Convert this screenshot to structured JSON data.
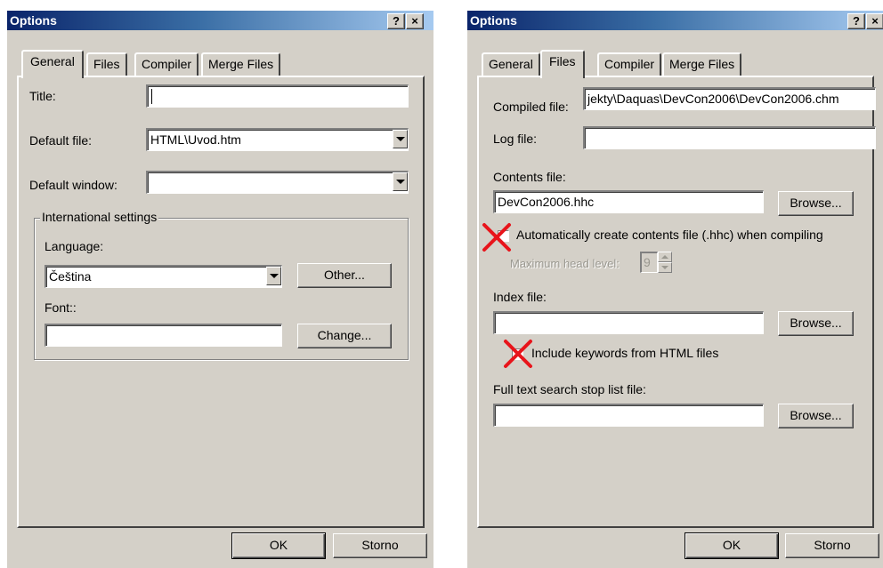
{
  "left_dialog": {
    "title": "Options",
    "help_button": "?",
    "close_button": "×",
    "tabs": [
      "General",
      "Files",
      "Compiler",
      "Merge Files"
    ],
    "active_tab": "General",
    "title_label": "Title:",
    "title_value": "",
    "default_file_label": "Default file:",
    "default_file_value": "HTML\\Uvod.htm",
    "default_window_label": "Default window:",
    "default_window_value": "",
    "intl_group_label": "International settings",
    "language_label": "Language:",
    "language_value": "Čeština",
    "other_button": "Other...",
    "font_label": "Font::",
    "font_value": "",
    "change_button": "Change...",
    "ok_button": "OK",
    "cancel_button": "Storno"
  },
  "right_dialog": {
    "title": "Options",
    "help_button": "?",
    "close_button": "×",
    "tabs": [
      "General",
      "Files",
      "Compiler",
      "Merge Files"
    ],
    "active_tab": "Files",
    "compiled_file_label": "Compiled file:",
    "compiled_file_value": "jekty\\Daquas\\DevCon2006\\DevCon2006.chm",
    "log_file_label": "Log file:",
    "log_file_value": "",
    "contents_file_label": "Contents file:",
    "contents_file_value": "DevCon2006.hhc",
    "browse_button": "Browse...",
    "auto_create_label": "Automatically create contents file (.hhc) when compiling",
    "auto_create_checked": false,
    "max_head_level_label": "Maximum head level:",
    "max_head_level_value": "9",
    "index_file_label": "Index file:",
    "index_file_value": "",
    "include_keywords_label": "Include keywords from HTML files",
    "include_keywords_checked": false,
    "stop_list_label": "Full text search stop list file:",
    "stop_list_value": "",
    "ok_button": "OK",
    "cancel_button": "Storno"
  },
  "colors": {
    "dialog_bg": "#d4d0c8",
    "title_start": "#0a246a",
    "title_end": "#a6caf0",
    "red_x_annotation": "#e8141b"
  }
}
